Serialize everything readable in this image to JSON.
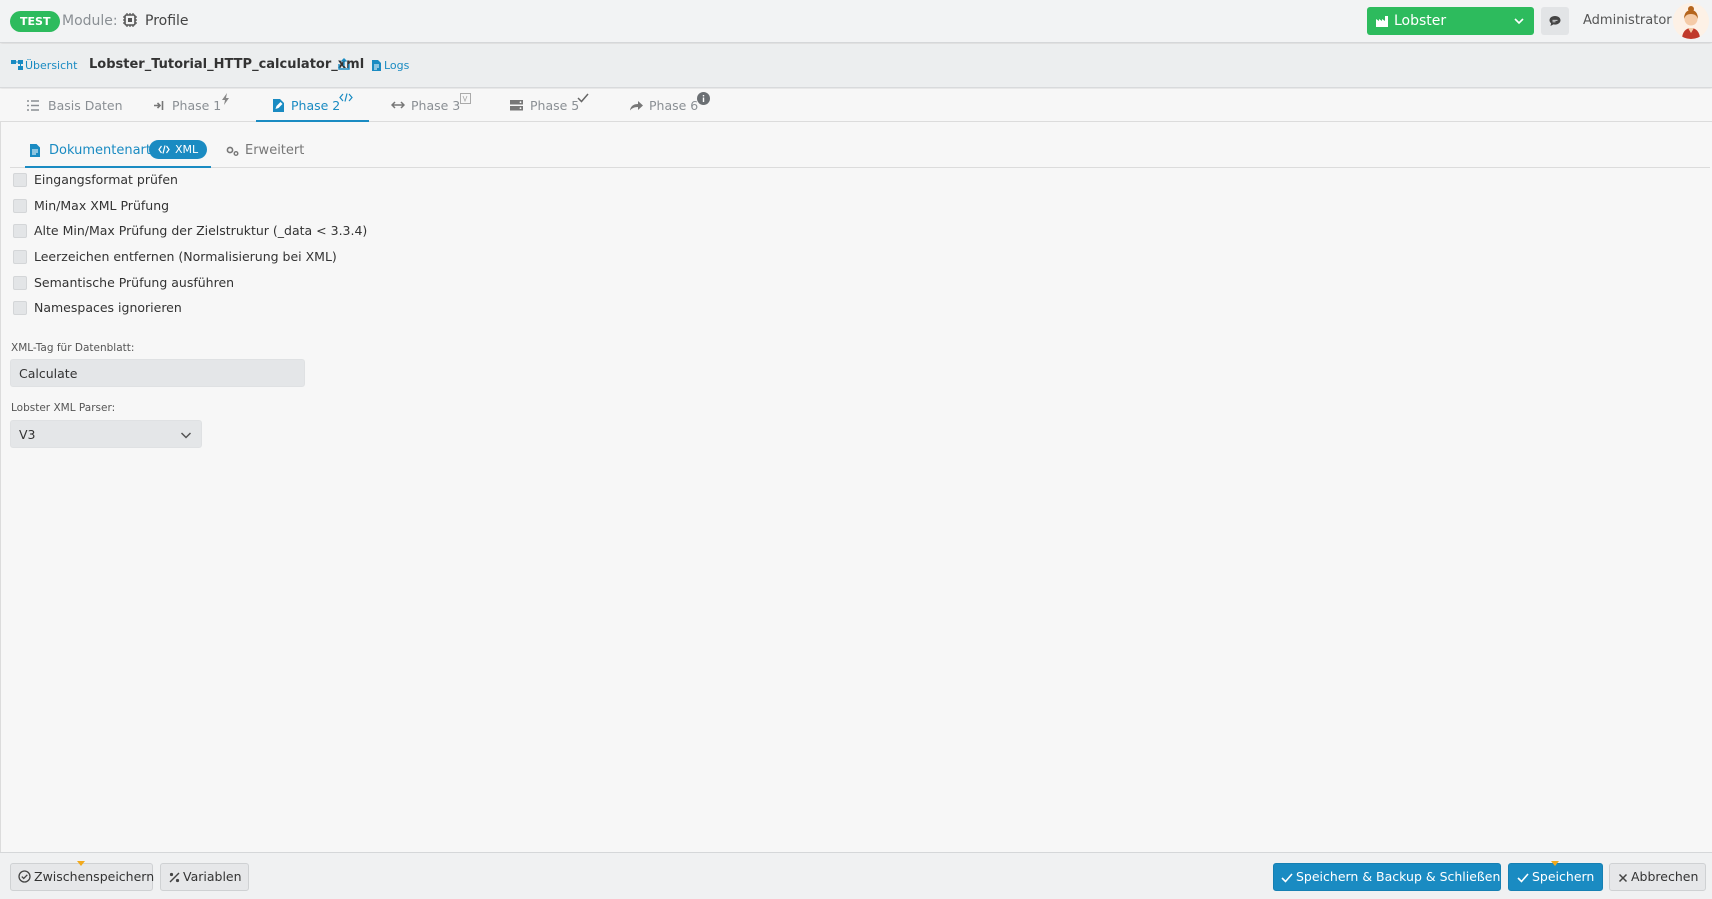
{
  "header": {
    "env_badge": "TEST",
    "module_label": "Module:",
    "module_name": "Profile",
    "tenant": "Lobster",
    "user": "Administrator"
  },
  "subheader": {
    "overview": "Übersicht",
    "profile_title": "Lobster_Tutorial_HTTP_calculator_xml",
    "logs": "Logs"
  },
  "phase_tabs": [
    {
      "label": "Basis Daten",
      "icon": "list-icon"
    },
    {
      "label": "Phase 1",
      "icon": "sign-in-icon",
      "badge_icon": "bolt-icon"
    },
    {
      "label": "Phase 2",
      "icon": "file-edit-icon",
      "badge_icon": "code-icon",
      "active": true
    },
    {
      "label": "Phase 3",
      "icon": "arrows-h-icon",
      "badge_icon": "table-icon"
    },
    {
      "label": "Phase 5",
      "icon": "server-icon",
      "badge_icon": "check-icon"
    },
    {
      "label": "Phase 6",
      "icon": "share-icon",
      "badge_icon": "info-circle-icon"
    }
  ],
  "sub_tabs": {
    "dokumentenart": "Dokumentenart",
    "xml_pill": "XML",
    "erweitert": "Erweitert"
  },
  "options": [
    {
      "label": "Eingangsformat prüfen",
      "checked": false
    },
    {
      "label": "Min/Max XML Prüfung",
      "checked": false
    },
    {
      "label": "Alte Min/Max Prüfung der Zielstruktur (_data < 3.3.4)",
      "checked": false
    },
    {
      "label": "Leerzeichen entfernen (Normalisierung bei XML)",
      "checked": false
    },
    {
      "label": "Semantische Prüfung ausführen",
      "checked": false
    },
    {
      "label": "Namespaces ignorieren",
      "checked": false
    }
  ],
  "form": {
    "xml_tag_label": "XML-Tag für Datenblatt:",
    "xml_tag_value": "Calculate",
    "parser_label": "Lobster XML Parser:",
    "parser_value": "V3"
  },
  "footer": {
    "zwischenspeichern": "Zwischenspeichern",
    "variablen": "Variablen",
    "save_backup_close": "Speichern & Backup & Schließen",
    "save": "Speichern",
    "cancel": "Abbrechen"
  },
  "colors": {
    "accent_blue": "#1a8bc2",
    "brand_green": "#2dbb5d",
    "notch_orange": "#f2a91c"
  }
}
